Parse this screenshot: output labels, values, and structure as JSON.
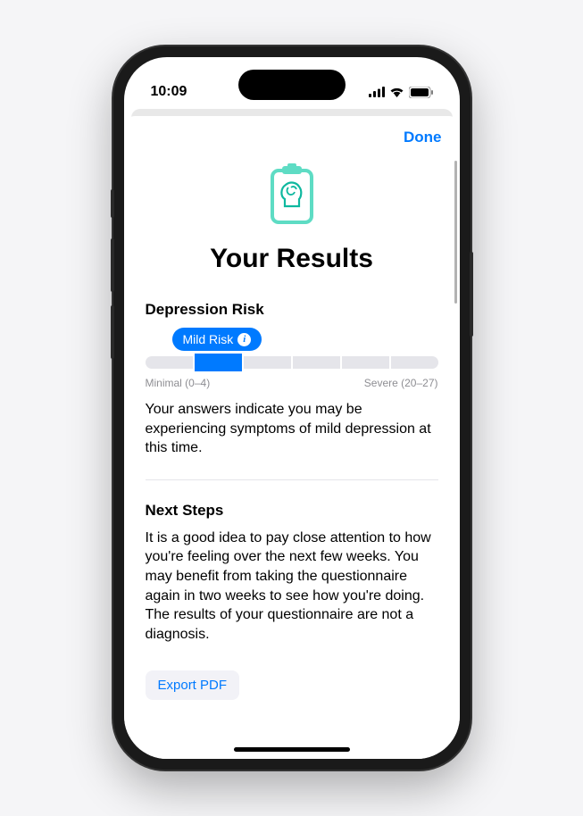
{
  "status": {
    "time": "10:09"
  },
  "modal": {
    "done": "Done"
  },
  "page": {
    "title": "Your Results"
  },
  "risk": {
    "section_title": "Depression Risk",
    "badge": "Mild Risk",
    "scale_min_label": "Minimal (0–4)",
    "scale_max_label": "Severe (20–27)",
    "active_segment_index": 1,
    "description": "Your answers indicate you may be experiencing symptoms of mild depression at this time."
  },
  "next_steps": {
    "title": "Next Steps",
    "body": "It is a good idea to pay close attention to how you're feeling over the next few weeks. You may benefit from taking the questionnaire again in two weeks to see how you're doing. The results of your questionnaire are not a diagnosis.",
    "export_label": "Export PDF"
  }
}
